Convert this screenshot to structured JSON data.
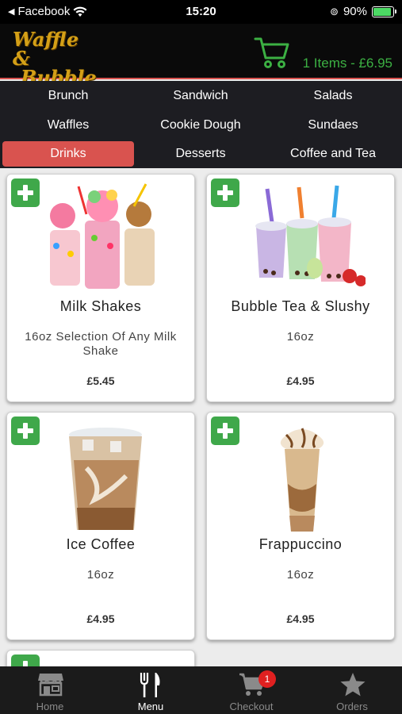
{
  "status_bar": {
    "back_app": "Facebook",
    "time": "15:20",
    "battery": "90%",
    "battery_level": 0.9
  },
  "header": {
    "logo_line1": "Waffle &",
    "logo_line2": "Bubble",
    "cart_summary": "1 Items - £6.95"
  },
  "categories": [
    {
      "label": "Brunch",
      "active": false
    },
    {
      "label": "Sandwich",
      "active": false
    },
    {
      "label": "Salads",
      "active": false
    },
    {
      "label": "Waffles",
      "active": false
    },
    {
      "label": "Cookie Dough",
      "active": false
    },
    {
      "label": "Sundaes",
      "active": false
    },
    {
      "label": "Drinks",
      "active": true
    },
    {
      "label": "Desserts",
      "active": false
    },
    {
      "label": "Coffee and Tea",
      "active": false
    }
  ],
  "products": [
    {
      "title": "Milk Shakes",
      "desc": "16oz Selection Of Any Milk Shake",
      "price": "£5.45"
    },
    {
      "title": "Bubble Tea & Slushy",
      "desc": "16oz",
      "price": "£4.95"
    },
    {
      "title": "Ice Coffee",
      "desc": "16oz",
      "price": "£4.95"
    },
    {
      "title": "Frappuccino",
      "desc": "16oz",
      "price": "£4.95"
    }
  ],
  "nav": {
    "home": "Home",
    "menu": "Menu",
    "checkout": "Checkout",
    "checkout_badge": "1",
    "orders": "Orders"
  },
  "colors": {
    "accent_red": "#d9534f",
    "cart_green": "#3cb043",
    "add_green": "#3fa84a"
  }
}
